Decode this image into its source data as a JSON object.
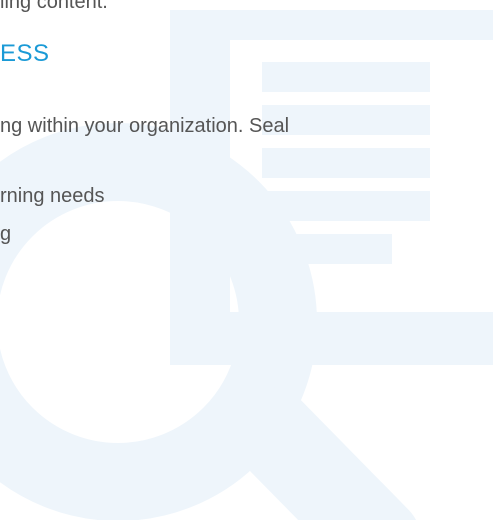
{
  "text": {
    "top_fragment": "ling content.",
    "heading": "ESS",
    "line_1": "ng within your organization. Seal",
    "line_2": "rning needs",
    "line_3": "g"
  },
  "icons": {
    "magnifier": "magnifying-glass-icon",
    "document": "document-icon"
  },
  "colors": {
    "heading": "#1a9ad6",
    "body_text": "#555555",
    "icon_fill": "#eef5fb"
  }
}
